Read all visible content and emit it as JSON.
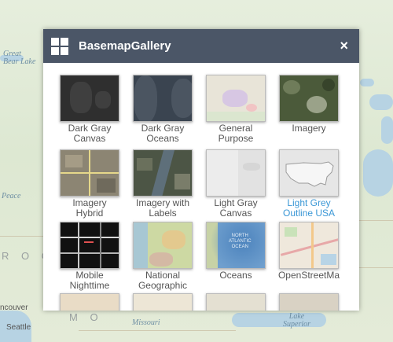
{
  "map": {
    "labels": {
      "great_bear_lake": "Great\nBear Lake",
      "peace": "Peace",
      "rocky": "R O C",
      "vancouver": "ncouver",
      "seattle": "Seattle",
      "missouri": "Missouri",
      "lake_superior": "Lake\nSuperior",
      "mo": "M O"
    }
  },
  "widget": {
    "title": "BasemapGallery",
    "close_glyph": "×"
  },
  "gallery": {
    "items": [
      {
        "label": "Dark Gray\nCanvas",
        "selected": false,
        "thumb": "dark-gray-canvas"
      },
      {
        "label": "Dark Gray\nOceans",
        "selected": false,
        "thumb": "dark-gray-oceans"
      },
      {
        "label": "General\nPurpose",
        "selected": false,
        "thumb": "general-purpose"
      },
      {
        "label": "Imagery",
        "selected": false,
        "thumb": "imagery"
      },
      {
        "label": "Imagery\nHybrid",
        "selected": false,
        "thumb": "imagery-hybrid"
      },
      {
        "label": "Imagery with\nLabels",
        "selected": false,
        "thumb": "imagery-with-labels"
      },
      {
        "label": "Light Gray\nCanvas",
        "selected": false,
        "thumb": "light-gray-canvas"
      },
      {
        "label": "Light Grey\nOutline USA",
        "selected": true,
        "thumb": "light-grey-outline-usa"
      },
      {
        "label": "Mobile\nNighttime",
        "selected": false,
        "thumb": "mobile-nighttime"
      },
      {
        "label": "National\nGeographic",
        "selected": false,
        "thumb": "national-geographic"
      },
      {
        "label": "Oceans",
        "selected": false,
        "thumb": "oceans"
      },
      {
        "label": "OpenStreetMa",
        "selected": false,
        "thumb": "openstreetmap"
      }
    ],
    "oceans_thumb_text": "NORTH\nATLANTIC\nOCEAN"
  },
  "colors": {
    "titlebar": "#4b5667",
    "selected_label": "#3a97d6",
    "label": "#555555"
  }
}
